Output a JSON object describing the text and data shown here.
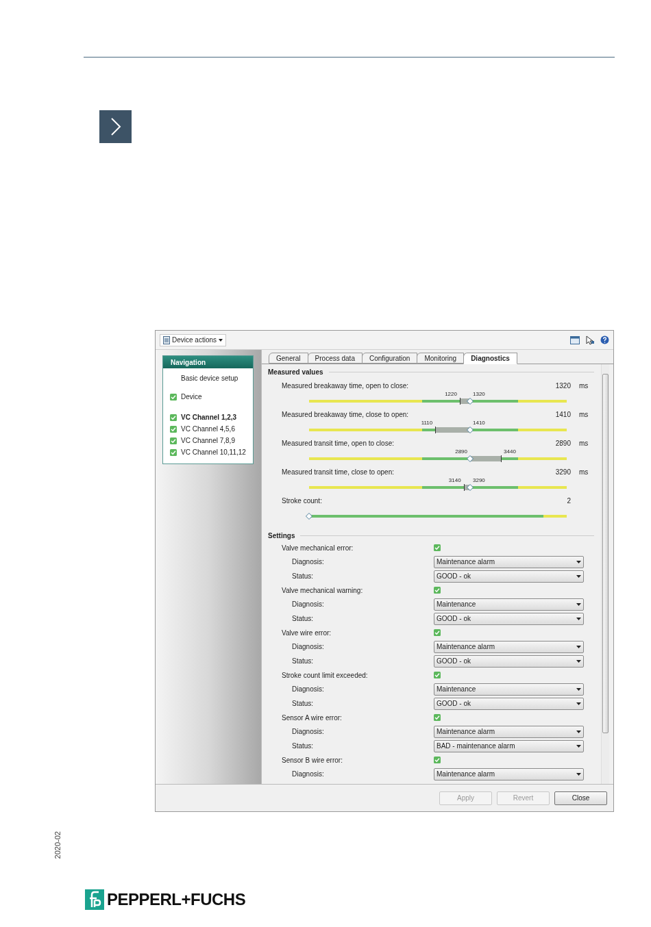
{
  "window": {
    "toolbar": {
      "menu": "Device actions"
    },
    "navigation": {
      "title": "Navigation",
      "items": [
        {
          "label": "Basic device setup",
          "checked": false,
          "selected": false
        },
        {
          "label": "Device",
          "checked": true,
          "selected": false
        },
        {
          "label": "VC Channel 1,2,3",
          "checked": true,
          "selected": true
        },
        {
          "label": "VC Channel 4,5,6",
          "checked": true,
          "selected": false
        },
        {
          "label": "VC Channel 7,8,9",
          "checked": true,
          "selected": false
        },
        {
          "label": "VC Channel 10,11,12",
          "checked": true,
          "selected": false
        }
      ]
    },
    "tabs": [
      {
        "label": "General",
        "selected": false
      },
      {
        "label": "Process data",
        "selected": false
      },
      {
        "label": "Configuration",
        "selected": false
      },
      {
        "label": "Monitoring",
        "selected": false
      },
      {
        "label": "Diagnostics",
        "selected": true
      }
    ],
    "measured_values": {
      "title": "Measured values",
      "rows": [
        {
          "kind": "range",
          "label": "Measured breakaway time, open to close:",
          "value": "1320",
          "unit": "ms",
          "bracket": {
            "label": "1220",
            "level": 0.585
          },
          "marker": {
            "label": "1320",
            "level": 0.625
          }
        },
        {
          "kind": "range",
          "label": "Measured breakaway time, close to open:",
          "value": "1410",
          "unit": "ms",
          "bracket": {
            "label": "1110",
            "level": 0.49
          },
          "marker": {
            "label": "1410",
            "level": 0.625
          }
        },
        {
          "kind": "range",
          "label": "Measured transit time, open to close:",
          "value": "2890",
          "unit": "ms",
          "bracket": {
            "label": "3440",
            "level": 0.745
          },
          "marker": {
            "label": "2890",
            "level": 0.625
          }
        },
        {
          "kind": "range",
          "label": "Measured transit time, close to open:",
          "value": "3290",
          "unit": "ms",
          "bracket": {
            "label": "3140",
            "level": 0.6
          },
          "marker": {
            "label": "3290",
            "level": 0.625
          }
        },
        {
          "kind": "count",
          "label": "Stroke count:",
          "value": "2",
          "marker": {
            "level": 0
          }
        }
      ]
    },
    "settings": {
      "title": "Settings",
      "groups": [
        {
          "label": "Valve mechanical error:",
          "checked": true,
          "diagnosis_label": "Diagnosis:",
          "diagnosis": "Maintenance alarm",
          "status_label": "Status:",
          "status": "GOOD - ok"
        },
        {
          "label": "Valve mechanical warning:",
          "checked": true,
          "diagnosis_label": "Diagnosis:",
          "diagnosis": "Maintenance",
          "status_label": "Status:",
          "status": "GOOD - ok"
        },
        {
          "label": "Valve wire error:",
          "checked": true,
          "diagnosis_label": "Diagnosis:",
          "diagnosis": "Maintenance alarm",
          "status_label": "Status:",
          "status": "GOOD - ok"
        },
        {
          "label": "Stroke count limit exceeded:",
          "checked": true,
          "diagnosis_label": "Diagnosis:",
          "diagnosis": "Maintenance",
          "status_label": "Status:",
          "status": "GOOD - ok"
        },
        {
          "label": "Sensor A wire error:",
          "checked": true,
          "diagnosis_label": "Diagnosis:",
          "diagnosis": "Maintenance alarm",
          "status_label": "Status:",
          "status": "BAD - maintenance alarm"
        },
        {
          "label": "Sensor B wire error:",
          "checked": true,
          "diagnosis_label": "Diagnosis:",
          "diagnosis": "Maintenance alarm"
        }
      ]
    },
    "buttons": [
      {
        "label": "Apply",
        "disabled": true
      },
      {
        "label": "Revert",
        "disabled": true
      },
      {
        "label": "Close",
        "disabled": false
      }
    ]
  },
  "footer": {
    "date": "2020-02",
    "logo": "PEPPERL+FUCHS"
  }
}
